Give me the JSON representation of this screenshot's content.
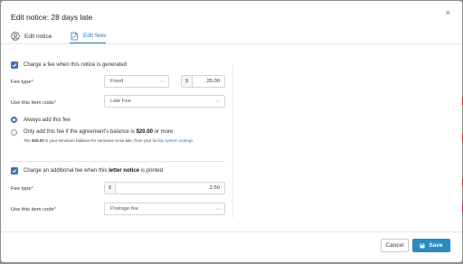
{
  "dialog": {
    "title": "Edit notice: 28 days late",
    "close_glyph": "×"
  },
  "tabs": [
    {
      "label": "Edit notice",
      "icon": "person-circle-icon",
      "active": false
    },
    {
      "label": "Edit fees",
      "icon": "document-fee-icon",
      "active": true
    }
  ],
  "generated_fee": {
    "checkbox_label": "Charge a fee when this notice is generated",
    "checked": true,
    "fee_type_label": "Fee type",
    "fee_type_value": "Fixed",
    "currency": "$",
    "amount": "25.00",
    "item_code_label": "Use this item code",
    "item_code_value": "Late Fee",
    "option_always": "Always add this fee",
    "option_only_prefix": "Only add this fee if the agreement's balance is ",
    "option_only_amount": "$20.00",
    "option_only_suffix": " or more",
    "selected_option": "always",
    "hint_prefix": "The ",
    "hint_amount": "$20.00",
    "hint_middle": " is your minimum balance for someone to be late, from your ",
    "hint_link": "facility system settings"
  },
  "printed_fee": {
    "checkbox_prefix": "Charge an additional fee when this ",
    "checkbox_bold": "letter notice",
    "checkbox_suffix": " is printed",
    "checked": true,
    "fee_type_label": "Fee type",
    "currency": "$",
    "amount": "2.50",
    "item_code_label": "Use this item code",
    "item_code_value": "Postage fee"
  },
  "required_mark": "*",
  "footer": {
    "cancel_label": "Cancel",
    "save_label": "Save"
  },
  "colors": {
    "accent": "#2a7ab8",
    "checkbox": "#3f6fb5",
    "save_button": "#2a8bbf",
    "required": "#c0392b"
  }
}
